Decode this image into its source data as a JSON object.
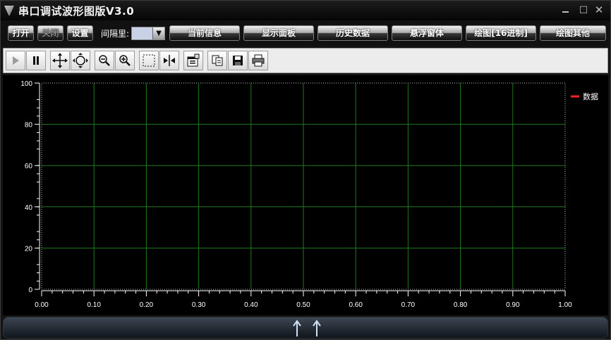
{
  "window": {
    "title": "串口调试波形图版V3.0",
    "minimize": "minimize",
    "maximize": "□",
    "close": "✕"
  },
  "command_bar": {
    "open": "打开",
    "close": "关闭",
    "settings": "设置",
    "interval_label": "间隔里:",
    "interval_value": "",
    "current_info": "当前信息",
    "display_panel": "显示面板",
    "history_data": "历史数据",
    "float_window": "悬浮窗体",
    "plot_hex": "绘图[16进制]",
    "plot_other": "绘图其他"
  },
  "toolbar": {
    "tools": [
      "play-icon",
      "pause-icon",
      "pan-icon",
      "zoom-fit-icon",
      "zoom-out-icon",
      "zoom-in-icon",
      "select-rect-icon",
      "fit-width-icon",
      "properties-icon",
      "copy-icon",
      "save-icon",
      "print-icon"
    ]
  },
  "chart_data": {
    "type": "line",
    "title": "",
    "xlabel": "",
    "ylabel": "",
    "xlim": [
      0,
      1
    ],
    "ylim": [
      0,
      100
    ],
    "x_ticks": [
      "0.00",
      "0.10",
      "0.20",
      "0.30",
      "0.40",
      "0.50",
      "0.60",
      "0.70",
      "0.80",
      "0.90",
      "1.00"
    ],
    "y_ticks": [
      "0",
      "20",
      "40",
      "60",
      "80",
      "100"
    ],
    "grid": true,
    "legend_position": "top-right",
    "series": [
      {
        "name": "数据",
        "values": [],
        "color": "#ff2020"
      }
    ]
  },
  "colors": {
    "grid": "#1e7a1e",
    "axis_text": "#ffffff",
    "legend_red": "#ff2020"
  }
}
